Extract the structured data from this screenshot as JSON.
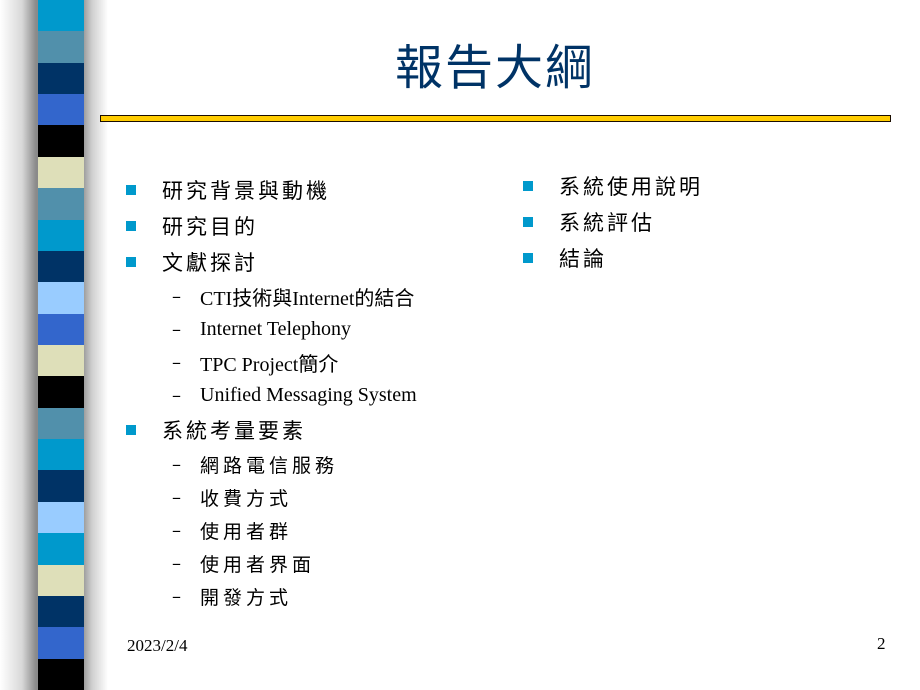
{
  "slide": {
    "title": "報告大綱",
    "colors": {
      "title": "#003366",
      "bullet": "#0099cc",
      "rule_fill": "#ffcc00",
      "rule_border": "#1a0d00"
    },
    "left_column": [
      {
        "label": "研究背景與動機",
        "children": []
      },
      {
        "label": "研究目的",
        "children": []
      },
      {
        "label": "文獻探討",
        "children": [
          "CTI技術與Internet的結合",
          "Internet Telephony",
          "TPC Project簡介",
          "Unified Messaging System"
        ]
      },
      {
        "label": "系統考量要素",
        "children": [
          "網路電信服務",
          "收費方式",
          "使用者群",
          "使用者界面",
          "開發方式"
        ]
      }
    ],
    "right_column": [
      {
        "label": "系統使用說明"
      },
      {
        "label": "系統評估"
      },
      {
        "label": "結論"
      }
    ],
    "sub_bullet_glyph": "–",
    "footer": {
      "date": "2023/2/4",
      "page_number": "2"
    },
    "decor_strip_colors": [
      "#0099cc",
      "#5190ab",
      "#003366",
      "#3366cc",
      "#000000",
      "#dedfb9",
      "#5190ab",
      "#0099cc",
      "#003366",
      "#99ccff",
      "#3366cc",
      "#dedfb9",
      "#000000",
      "#5190ab",
      "#0099cc",
      "#003366",
      "#99ccff",
      "#0099cc",
      "#dedfb9",
      "#003366",
      "#3366cc",
      "#000000"
    ]
  }
}
